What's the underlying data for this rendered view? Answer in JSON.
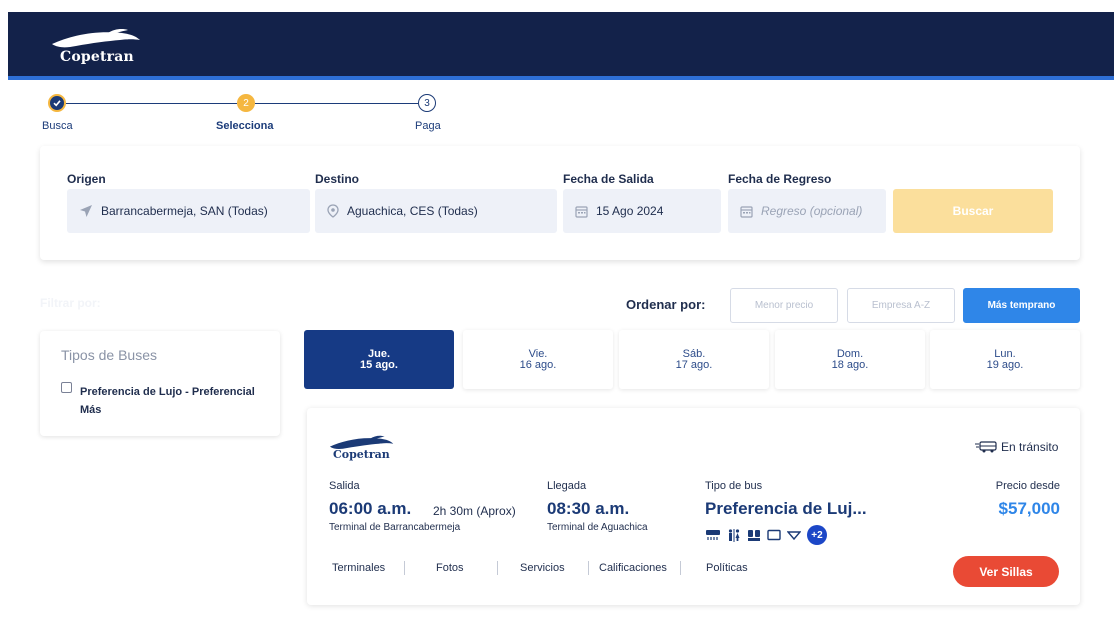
{
  "brand": {
    "name": "Copetran"
  },
  "stepper": {
    "steps": [
      {
        "number": "1",
        "label": "Busca"
      },
      {
        "number": "2",
        "label": "Selecciona"
      },
      {
        "number": "3",
        "label": "Paga"
      }
    ]
  },
  "search": {
    "origin": {
      "label": "Origen",
      "value": "Barrancabermeja, SAN (Todas)"
    },
    "destination": {
      "label": "Destino",
      "value": "Aguachica, CES (Todas)"
    },
    "departure": {
      "label": "Fecha de Salida",
      "value": "15 Ago 2024"
    },
    "return": {
      "label": "Fecha de Regreso",
      "placeholder": "Regreso (opcional)"
    },
    "search_button": "Buscar"
  },
  "filters": {
    "title": "Filtrar por:",
    "bus_types_title": "Tipos de Buses",
    "bus_types": [
      {
        "label": "Preferencia de Lujo - Preferencial Más",
        "checked": false
      }
    ]
  },
  "sort": {
    "label": "Ordenar por:",
    "options": [
      {
        "label": "Menor precio",
        "active": false
      },
      {
        "label": "Empresa A-Z",
        "active": false
      },
      {
        "label": "Más temprano",
        "active": true
      }
    ]
  },
  "date_tabs": [
    {
      "day": "Jue.",
      "date": "15 ago.",
      "active": true
    },
    {
      "day": "Vie.",
      "date": "16 ago.",
      "active": false
    },
    {
      "day": "Sáb.",
      "date": "17 ago.",
      "active": false
    },
    {
      "day": "Dom.",
      "date": "18 ago.",
      "active": false
    },
    {
      "day": "Lun.",
      "date": "19 ago.",
      "active": false
    }
  ],
  "result": {
    "company": "Copetran",
    "status": "En tránsito",
    "departure": {
      "label": "Salida",
      "time": "06:00 a.m.",
      "duration": "2h 30m (Aprox)",
      "terminal": "Terminal de Barrancabermeja"
    },
    "arrival": {
      "label": "Llegada",
      "time": "08:30 a.m.",
      "terminal": "Terminal de Aguachica"
    },
    "bus_type": {
      "label": "Tipo de bus",
      "value": "Preferencia de Luj..."
    },
    "amenities": [
      "air-conditioning-icon",
      "restroom-icon",
      "reclining-seat-icon",
      "screen-icon",
      "wifi-icon"
    ],
    "amenities_more": "+2",
    "price": {
      "label": "Precio desde",
      "value": "$57,000"
    },
    "links": [
      "Terminales",
      "Fotos",
      "Servicios",
      "Calificaciones",
      "Políticas"
    ],
    "cta": "Ver Sillas"
  },
  "colors": {
    "header_bg": "#13224a",
    "accent_blue": "#2f86e8",
    "step_active": "#f5b740",
    "cta_red": "#e94a35",
    "search_button_disabled": "#fbdf9c"
  }
}
